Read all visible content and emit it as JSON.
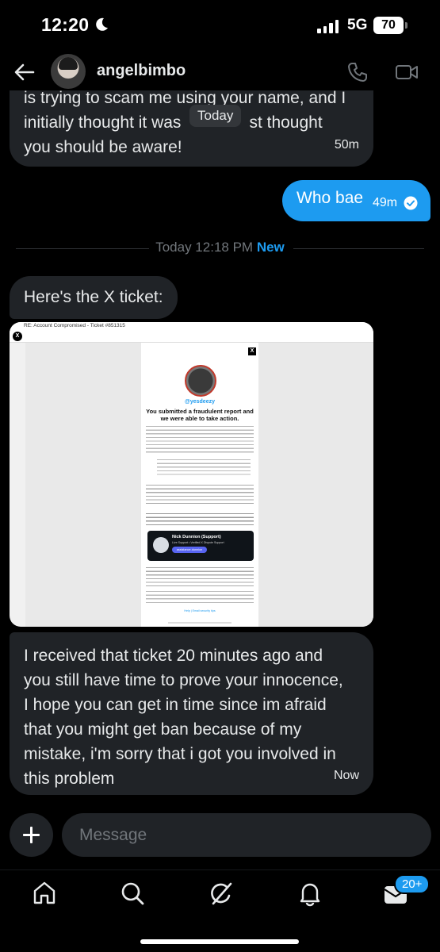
{
  "status_bar": {
    "time": "12:20",
    "network": "5G",
    "battery": "70"
  },
  "header": {
    "username": "angelbimbo"
  },
  "messages": {
    "received_top": {
      "line1": "is trying to scam me using your name, and I",
      "line2": "initially thought it was",
      "line2b": "st thought",
      "line3": "you should be aware!",
      "time": "50m"
    },
    "today_pill": "Today",
    "sent": {
      "text": "Who bae",
      "time": "49m"
    },
    "divider": {
      "text": "Today 12:18 PM",
      "new_label": "New"
    },
    "ticket_intro": "Here's the X ticket:",
    "long_message": {
      "lines": [
        "I received that ticket 20 minutes ago and",
        "you still have time to prove your innocence,",
        "I hope you can get in time since im afraid",
        "that you might get ban because of my",
        "mistake, i'm sorry that i got you involved in",
        "this problem"
      ],
      "time": "Now"
    }
  },
  "ticket_image": {
    "subject": "RE: Account Compromised - Ticket #851315",
    "handle": "@yesdeezy",
    "heading": "You submitted a fraudulent report and we were able to take action.",
    "card_name": "Nick Dunnion (Support)",
    "card_role": "Live Support • Verified X Dispute Support",
    "card_button": "assistance.dunnion",
    "footer_links": "Help | Email security tips"
  },
  "composer": {
    "placeholder": "Message"
  },
  "tabbar": {
    "tabs": [
      "home-icon",
      "search-icon",
      "grok-icon",
      "notifications-icon",
      "messages-icon"
    ],
    "badge": "20+"
  },
  "colors": {
    "accent": "#1d9bf0",
    "bubble": "#202327",
    "background": "#000000"
  }
}
